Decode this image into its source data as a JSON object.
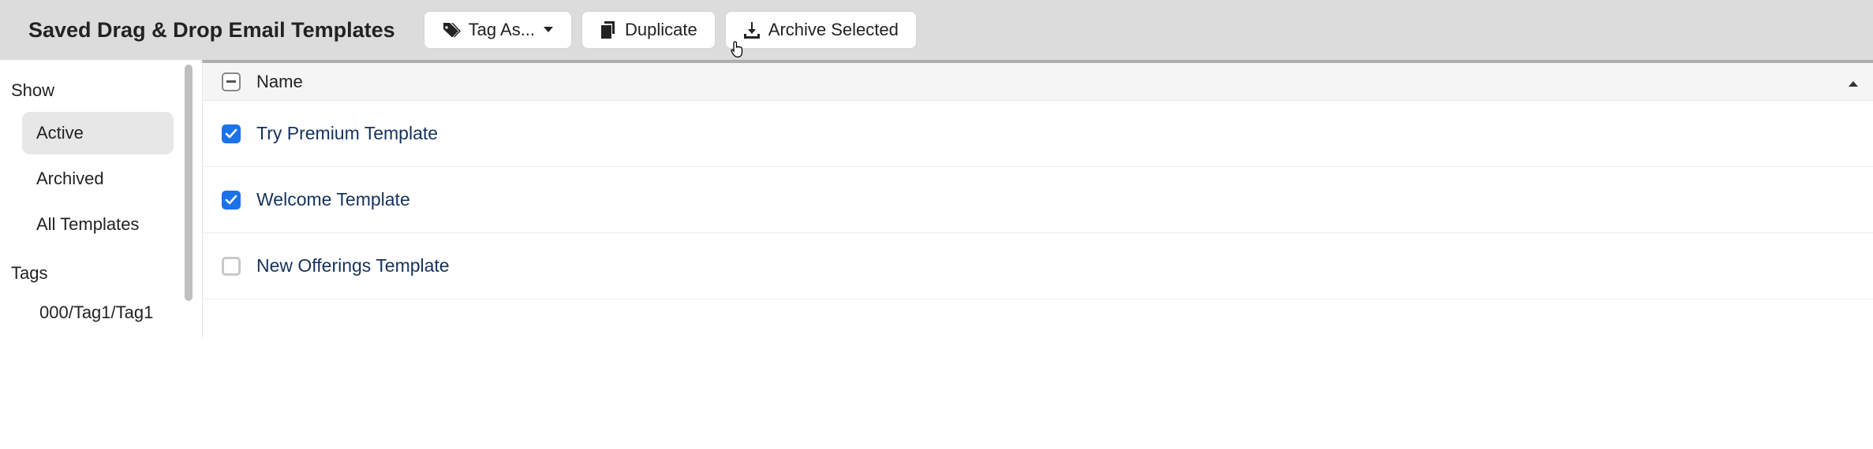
{
  "header": {
    "title": "Saved Drag & Drop Email Templates",
    "buttons": {
      "tag_as": "Tag As...",
      "duplicate": "Duplicate",
      "archive": "Archive Selected"
    }
  },
  "sidebar": {
    "show_heading": "Show",
    "items": [
      {
        "label": "Active",
        "active": true
      },
      {
        "label": "Archived",
        "active": false
      },
      {
        "label": "All Templates",
        "active": false
      }
    ],
    "tags_heading": "Tags",
    "tags": [
      {
        "label": "000/Tag1/Tag1"
      }
    ]
  },
  "table": {
    "header": {
      "name": "Name"
    },
    "select_all_state": "indeterminate",
    "rows": [
      {
        "name": "Try Premium Template",
        "checked": true
      },
      {
        "name": "Welcome Template",
        "checked": true
      },
      {
        "name": "New Offerings Template",
        "checked": false
      }
    ]
  }
}
